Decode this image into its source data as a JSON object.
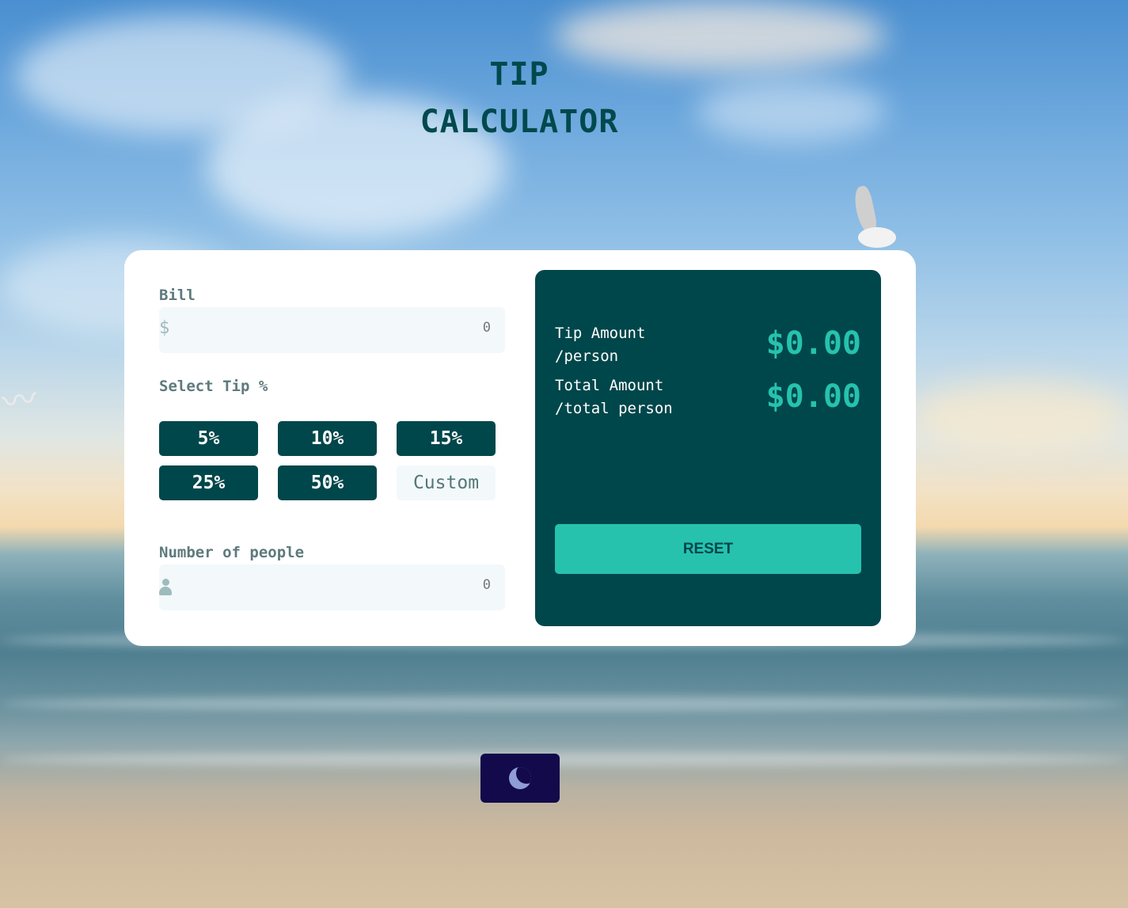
{
  "app": {
    "title_line1": "TIP",
    "title_line2": "CALCULATOR"
  },
  "bill": {
    "label": "Bill",
    "currency_symbol": "$",
    "value": "",
    "placeholder": "0"
  },
  "tip": {
    "label": "Select Tip %",
    "options": [
      "5%",
      "10%",
      "15%",
      "25%",
      "50%"
    ],
    "custom_placeholder": "Custom"
  },
  "people": {
    "label": "Number of people",
    "icon": "person-icon",
    "value": "",
    "placeholder": "0"
  },
  "results": {
    "tip_amount_label": "Tip Amount",
    "tip_amount_sub": "/person",
    "tip_amount_value": "$0.00",
    "total_label": "Total Amount",
    "total_sub": "/total person",
    "total_value": "$0.00",
    "reset_label": "RESET"
  },
  "theme_toggle": {
    "icon": "moon-icon"
  },
  "colors": {
    "primary_dark": "#00474b",
    "accent": "#26c2ae",
    "input_bg": "#f3f8fb",
    "toggle_bg": "#120a4a"
  }
}
